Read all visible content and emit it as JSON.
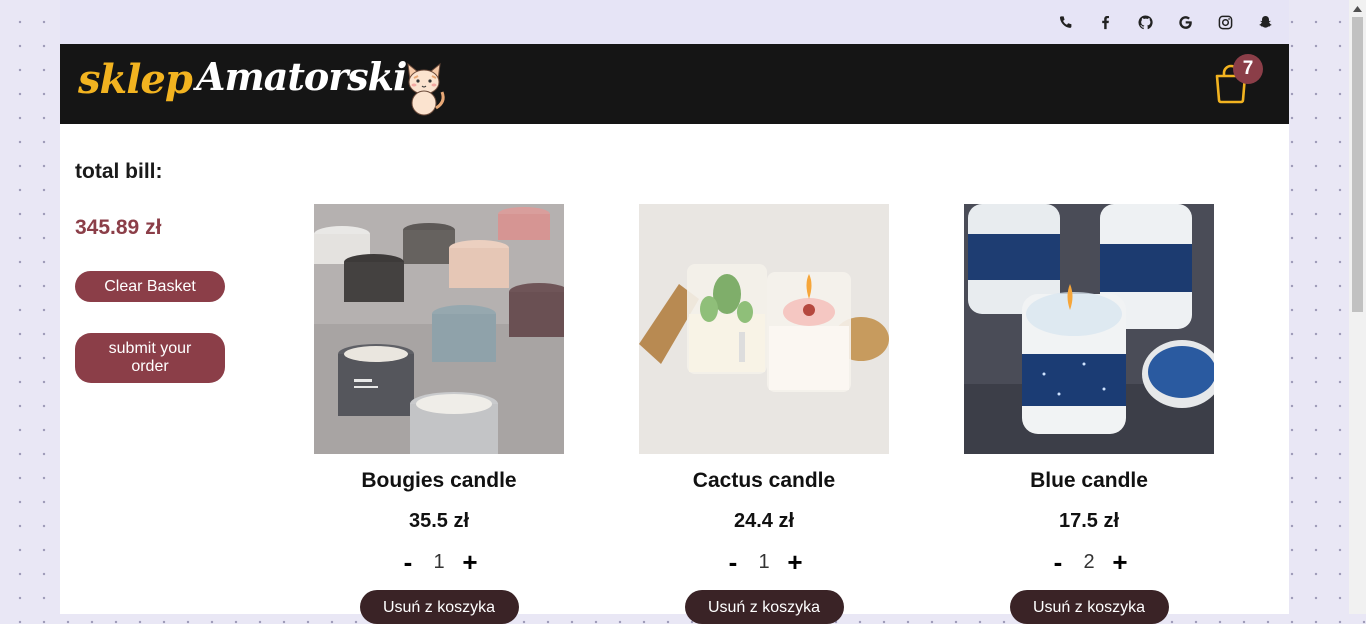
{
  "social": [
    {
      "icon": "phone-icon"
    },
    {
      "icon": "facebook-icon"
    },
    {
      "icon": "github-icon"
    },
    {
      "icon": "google-icon"
    },
    {
      "icon": "instagram-icon"
    },
    {
      "icon": "snapchat-icon"
    }
  ],
  "header": {
    "logo_part1": "sklep",
    "logo_part2": "Amatorski",
    "cart_count": "7"
  },
  "summary": {
    "total_label": "total bill:",
    "total_value": "345.89 zł",
    "clear_label": "Clear Basket",
    "submit_label": "submit your order"
  },
  "products": [
    {
      "name": "Bougies candle",
      "price": "35.5 zł",
      "qty": "1",
      "minus": "-",
      "plus": "+",
      "remove_label": "Usuń z koszyka"
    },
    {
      "name": "Cactus candle",
      "price": "24.4 zł",
      "qty": "1",
      "minus": "-",
      "plus": "+",
      "remove_label": "Usuń z koszyka"
    },
    {
      "name": "Blue candle",
      "price": "17.5 zł",
      "qty": "2",
      "minus": "-",
      "plus": "+",
      "remove_label": "Usuń z koszyka"
    }
  ],
  "colors": {
    "accent": "#8b3e48",
    "header_bg": "#151515",
    "logo_yellow": "#f2b320",
    "remove_bg": "#3a2326"
  }
}
